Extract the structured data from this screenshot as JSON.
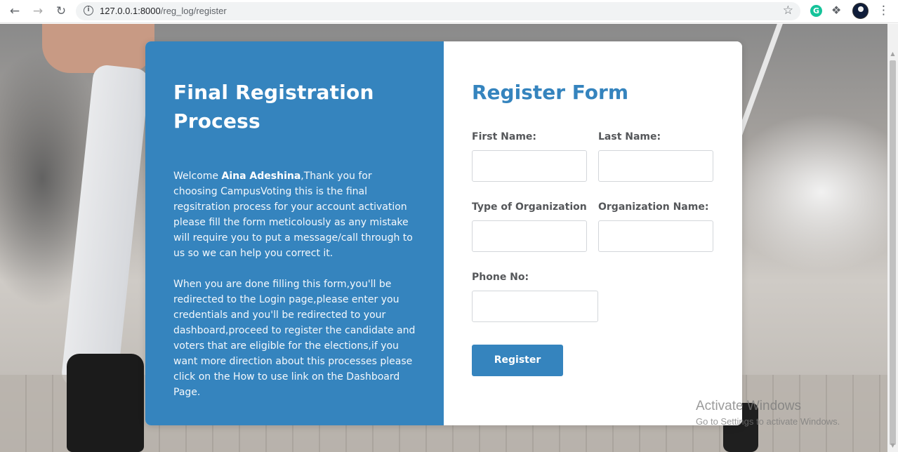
{
  "browser": {
    "url_host": "127.0.0.1:8000",
    "url_path": "/reg_log/register",
    "back_icon": "arrow-left-icon",
    "forward_icon": "arrow-right-icon",
    "reload_icon": "reload-icon",
    "extension_g_label": "G"
  },
  "intro": {
    "title": "Final Registration Process",
    "welcome_prefix": "Welcome ",
    "user_name": "Aina Adeshina",
    "welcome_rest": ",Thank you for choosing CampusVoting this is the final regsitration process for your account activation please fill the form meticolously as any mistake will require you to put a message/call through to us so we can help you correct it.",
    "paragraph2": "When you are done filling this form,you'll be redirected to the Login page,please enter you credentials and you'll be redirected to your dashboard,proceed to register the candidate and voters that are eligible for the elections,if you want more direction about this processes please click on the How to use link on the Dashboard Page."
  },
  "form": {
    "title": "Register Form",
    "first_name_label": "First Name:",
    "first_name_value": "",
    "last_name_label": "Last Name:",
    "last_name_value": "",
    "org_type_label": "Type of Organization",
    "org_type_value": "",
    "org_name_label": "Organization Name:",
    "org_name_value": "",
    "phone_label": "Phone No:",
    "phone_value": "",
    "submit_label": "Register"
  },
  "watermark": {
    "title": "Activate Windows",
    "subtitle": "Go to Settings to activate Windows."
  },
  "colors": {
    "accent": "#3584be",
    "label": "#55575a",
    "input_border": "#d3d6da"
  }
}
